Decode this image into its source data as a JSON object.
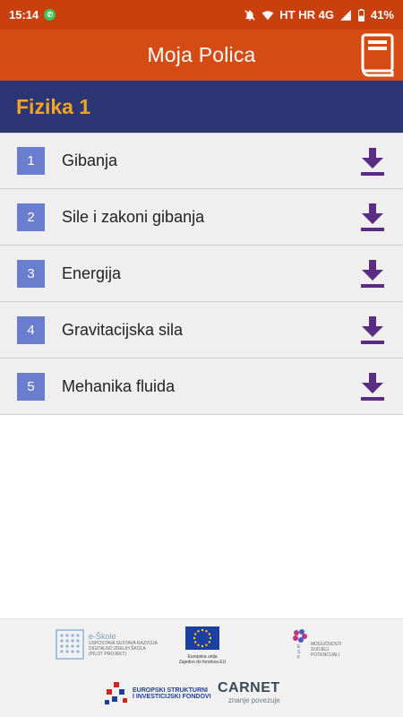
{
  "status_bar": {
    "time": "15:14",
    "network": "HT HR 4G",
    "battery": "41%"
  },
  "app_bar": {
    "title": "Moja Polica",
    "book_icon": "book-icon"
  },
  "section": {
    "title": "Fizika 1"
  },
  "chapters": [
    {
      "number": "1",
      "title": "Gibanja"
    },
    {
      "number": "2",
      "title": "Sile i zakoni gibanja"
    },
    {
      "number": "3",
      "title": "Energija"
    },
    {
      "number": "4",
      "title": "Gravitacijska sila"
    },
    {
      "number": "5",
      "title": "Mehanika fluida"
    }
  ],
  "footer": {
    "eskole_title": "e-Škole",
    "eskole_sub1": "USPOSTAVA SUSTAVA RAZVOJA",
    "eskole_sub2": "DIGITALNO ZRELIH ŠKOLA",
    "eskole_sub3": "(PILOT PROJEKT)",
    "eu_line1": "Europska unija",
    "eu_line2": "Zajedno do fondova EU",
    "esf_text1": "MOGUĆNOSTI",
    "esf_text2": "SUDJELI",
    "esf_text3": "POTENCIJALI",
    "esi_line1": "EUROPSKI STRUKTURNI",
    "esi_line2": "I INVESTICIJSKI FONDOVI",
    "carnet_name": "CARNET",
    "carnet_tagline": "znanje povezuje"
  },
  "colors": {
    "status_bar": "#c93f0d",
    "app_bar": "#d54b14",
    "section_header": "#2c3675",
    "section_title": "#f4a623",
    "badge": "#6a7dcf",
    "download_icon": "#5a2d82"
  }
}
